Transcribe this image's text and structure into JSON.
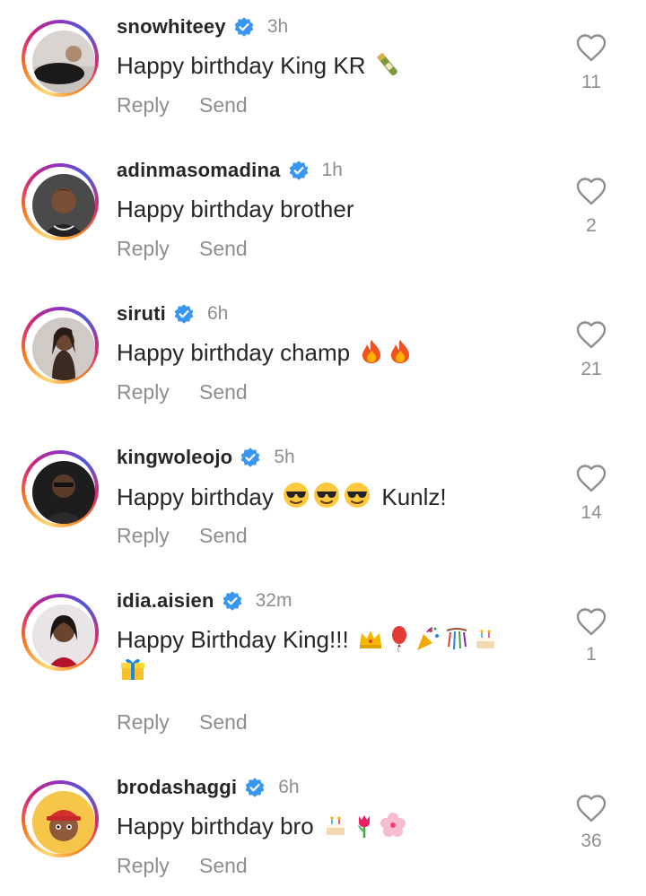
{
  "comments": [
    {
      "username": "snowhiteey",
      "time": "3h",
      "text": "Happy birthday King KR",
      "emoji": "🍾",
      "reply": "Reply",
      "send": "Send",
      "likes": "11"
    },
    {
      "username": "adinmasomadina",
      "time": "1h",
      "text": "Happy birthday brother",
      "emoji": "",
      "reply": "Reply",
      "send": "Send",
      "likes": "2"
    },
    {
      "username": "siruti",
      "time": "6h",
      "text": "Happy birthday champ",
      "emoji": "🔥🔥",
      "reply": "Reply",
      "send": "Send",
      "likes": "21"
    },
    {
      "username": "kingwoleojo",
      "time": "5h",
      "text": "Happy birthday",
      "emoji": "😎😎😎",
      "text_after": "Kunlz!",
      "reply": "Reply",
      "send": "Send",
      "likes": "14"
    },
    {
      "username": "idia.aisien",
      "time": "32m",
      "text": "Happy Birthday King!!!",
      "emoji": "👑🎈🎉🎊🎂",
      "emoji_line2": "🎁",
      "reply": "Reply",
      "send": "Send",
      "likes": "1"
    },
    {
      "username": "brodashaggi",
      "time": "6h",
      "text": "Happy birthday bro",
      "emoji": "🎂🌷🌸",
      "reply": "Reply",
      "send": "Send",
      "likes": "36"
    }
  ],
  "colors": {
    "verified": "#3897f0",
    "secondary_text": "#8e8e8e",
    "primary_text": "#262626"
  },
  "icons": {
    "verified": "verified-badge-icon",
    "like": "heart-outline-icon"
  }
}
